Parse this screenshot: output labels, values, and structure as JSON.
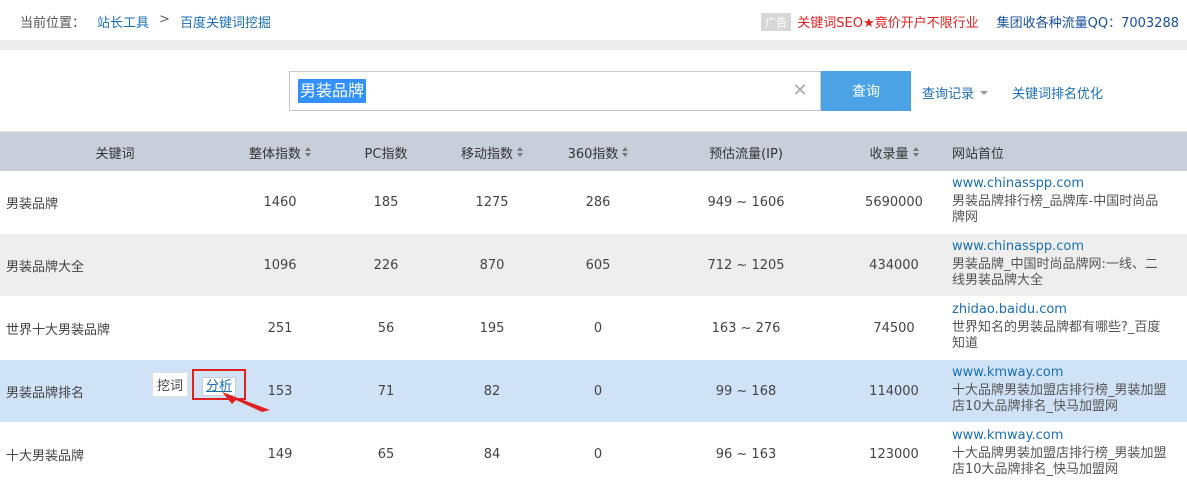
{
  "breadcrumb": {
    "prefix": "当前位置：",
    "items": [
      "站长工具",
      "百度关键词挖掘"
    ],
    "separator": ">"
  },
  "ad": {
    "badge": "广告",
    "red_text": "关键词SEO★竟价开户不限行业",
    "blue_text": "集团收各种流量QQ：7003288"
  },
  "search": {
    "value": "男装品牌",
    "clear_icon": "close-icon",
    "button_label": "查询",
    "history_label": "查询记录",
    "rank_label": "关键词排名优化"
  },
  "table": {
    "headers": [
      "关键词",
      "整体指数",
      "PC指数",
      "移动指数",
      "360指数",
      "预估流量(IP)",
      "收录量",
      "网站首位"
    ],
    "rows": [
      {
        "keyword": "男装品牌",
        "total": "1460",
        "pc": "185",
        "mobile": "1275",
        "s360": "286",
        "traffic": "949 ~ 1606",
        "indexed": "5690000",
        "url": "www.chinasspp.com",
        "desc": "男装品牌排行榜_品牌库-中国时尚品牌网"
      },
      {
        "keyword": "男装品牌大全",
        "total": "1096",
        "pc": "226",
        "mobile": "870",
        "s360": "605",
        "traffic": "712 ~ 1205",
        "indexed": "434000",
        "url": "www.chinasspp.com",
        "desc": "男装品牌_中国时尚品牌网:一线、二线男装品牌大全"
      },
      {
        "keyword": "世界十大男装品牌",
        "total": "251",
        "pc": "56",
        "mobile": "195",
        "s360": "0",
        "traffic": "163 ~ 276",
        "indexed": "74500",
        "url": "zhidao.baidu.com",
        "desc": "世界知名的男装品牌都有哪些?_百度知道"
      },
      {
        "keyword": "男装品牌排名",
        "total": "153",
        "pc": "71",
        "mobile": "82",
        "s360": "0",
        "traffic": "99 ~ 168",
        "indexed": "114000",
        "url": "www.kmway.com",
        "desc": "十大品牌男装加盟店排行榜_男装加盟店10大品牌排名_快马加盟网"
      },
      {
        "keyword": "十大男装品牌",
        "total": "149",
        "pc": "65",
        "mobile": "84",
        "s360": "0",
        "traffic": "96 ~ 163",
        "indexed": "123000",
        "url": "www.kmway.com",
        "desc": "十大品牌男装加盟店排行榜_男装加盟店10大品牌排名_快马加盟网"
      }
    ]
  },
  "row_actions": {
    "dig_label": "挖词",
    "analyze_label": "分析"
  },
  "colors": {
    "header_bg": "#c8cfdb",
    "highlight_row": "#cfe2f6",
    "alt_row": "#eeeeee",
    "button": "#4ba3e6",
    "link": "#1a6fb5",
    "annotation": "#e02020"
  }
}
